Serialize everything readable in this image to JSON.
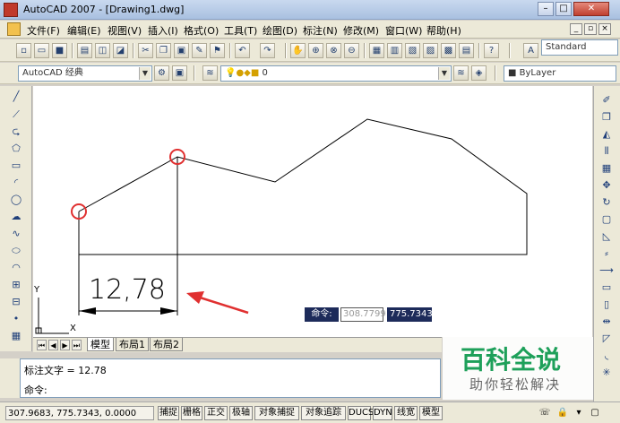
{
  "window": {
    "title": "AutoCAD 2007 - [Drawing1.dwg]",
    "min": "–",
    "max": "□",
    "close": "✕"
  },
  "menubar": {
    "items": [
      "文件(F)",
      "编辑(E)",
      "视图(V)",
      "插入(I)",
      "格式(O)",
      "工具(T)",
      "绘图(D)",
      "标注(N)",
      "修改(M)",
      "窗口(W)",
      "帮助(H)"
    ],
    "mdi_min": "_",
    "mdi_max": "▫",
    "mdi_close": "×"
  },
  "toolbar": {
    "text_style": "Standard",
    "workspace": "AutoCAD 经典",
    "layer": "0",
    "color": "ByLayer"
  },
  "drawing": {
    "dimension_text": "12,78",
    "ucs_x": "X",
    "ucs_y": "Y"
  },
  "dynamic_input": {
    "label": "命令:",
    "x_value": "308.7799",
    "y_value": "775.7343"
  },
  "tabs": {
    "model": "模型",
    "layout1": "布局1",
    "layout2": "布局2"
  },
  "command": {
    "history": "标注文字 = 12.78",
    "prompt": "命令:"
  },
  "status": {
    "coords": "307.9683, 775.7343, 0.0000",
    "toggles": [
      "捕捉",
      "栅格",
      "正交",
      "极轴",
      "对象捕捉",
      "对象追踪",
      "DUCS",
      "DYN",
      "线宽",
      "模型"
    ]
  },
  "watermark": {
    "title": "百科全说",
    "subtitle": "助你轻松解决"
  },
  "colors": {
    "accent": "#1d2b5a",
    "highlight": "#e03030",
    "brand": "#1ea05a"
  }
}
